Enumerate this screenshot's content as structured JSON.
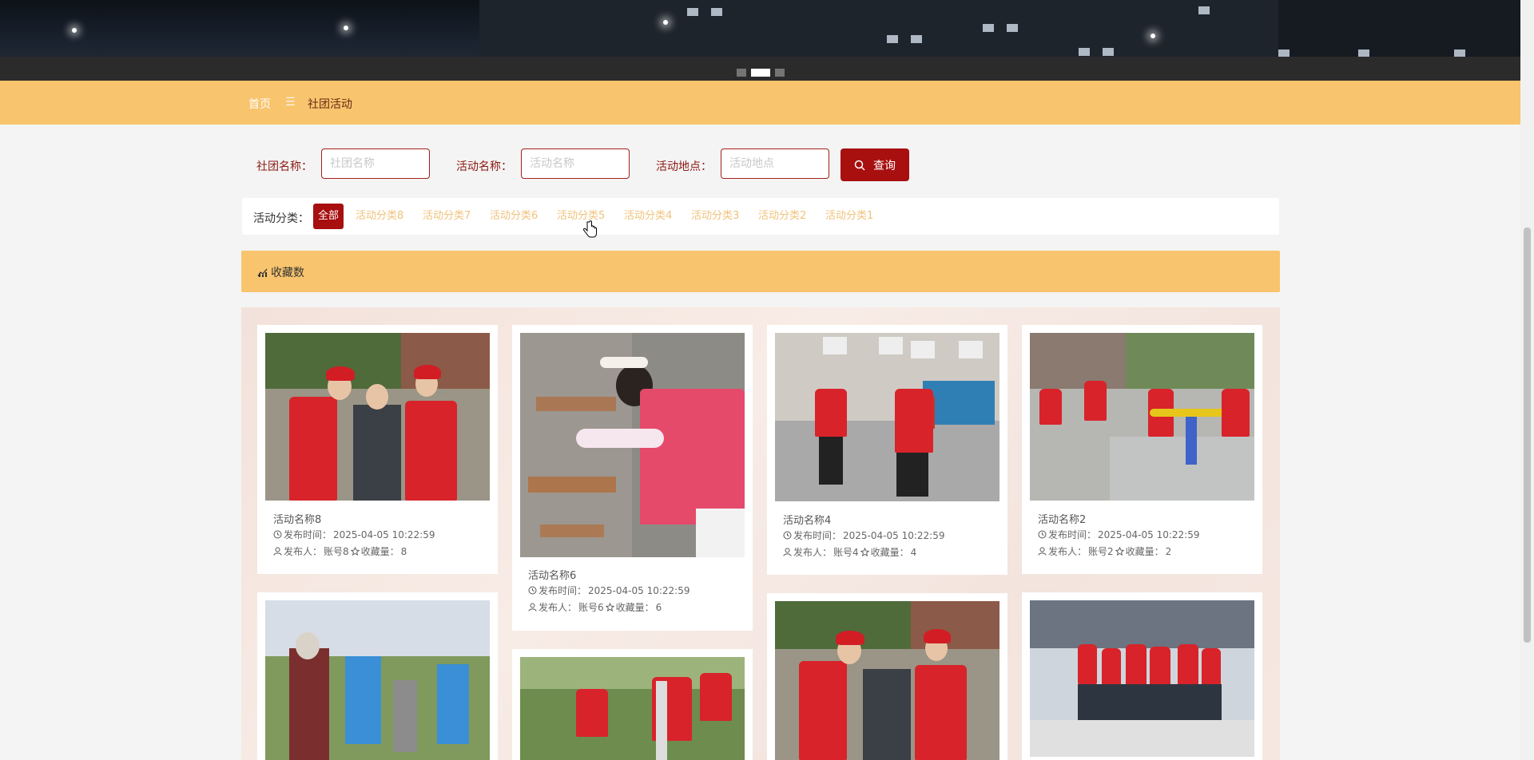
{
  "breadcrumb": {
    "home": "首页",
    "separator": "☰",
    "current": "社团活动"
  },
  "search": {
    "fields": [
      {
        "label": "社团名称：",
        "placeholder": "社团名称"
      },
      {
        "label": "活动名称：",
        "placeholder": "活动名称"
      },
      {
        "label": "活动地点：",
        "placeholder": "活动地点"
      }
    ],
    "button_label": "查询"
  },
  "categories": {
    "title": "活动分类：",
    "items": [
      "全部",
      "活动分类8",
      "活动分类7",
      "活动分类6",
      "活动分类5",
      "活动分类4",
      "活动分类3",
      "活动分类2",
      "活动分类1"
    ],
    "selected": "全部"
  },
  "section": {
    "title": "收藏数"
  },
  "labels": {
    "publish_time": "发布时间：",
    "publisher": "发布人：",
    "favorites": "收藏量："
  },
  "cards": [
    {
      "name": "活动名称8",
      "time": "2025-04-05 10:22:59",
      "publisher": "账号8",
      "favorites": "8"
    },
    {
      "name": "活动名称6",
      "time": "2025-04-05 10:22:59",
      "publisher": "账号6",
      "favorites": "6"
    },
    {
      "name": "活动名称4",
      "time": "2025-04-05 10:22:59",
      "publisher": "账号4",
      "favorites": "4"
    },
    {
      "name": "活动名称2",
      "time": "2025-04-05 10:22:59",
      "publisher": "账号2",
      "favorites": "2"
    }
  ],
  "colors": {
    "accent": "#a80f0f",
    "bar": "#f8c46d",
    "category": "#f0c27a"
  },
  "icons": {
    "search": "search-icon",
    "chart": "chart-icon",
    "clock": "clock-icon",
    "user": "user-icon",
    "star": "star-icon"
  }
}
